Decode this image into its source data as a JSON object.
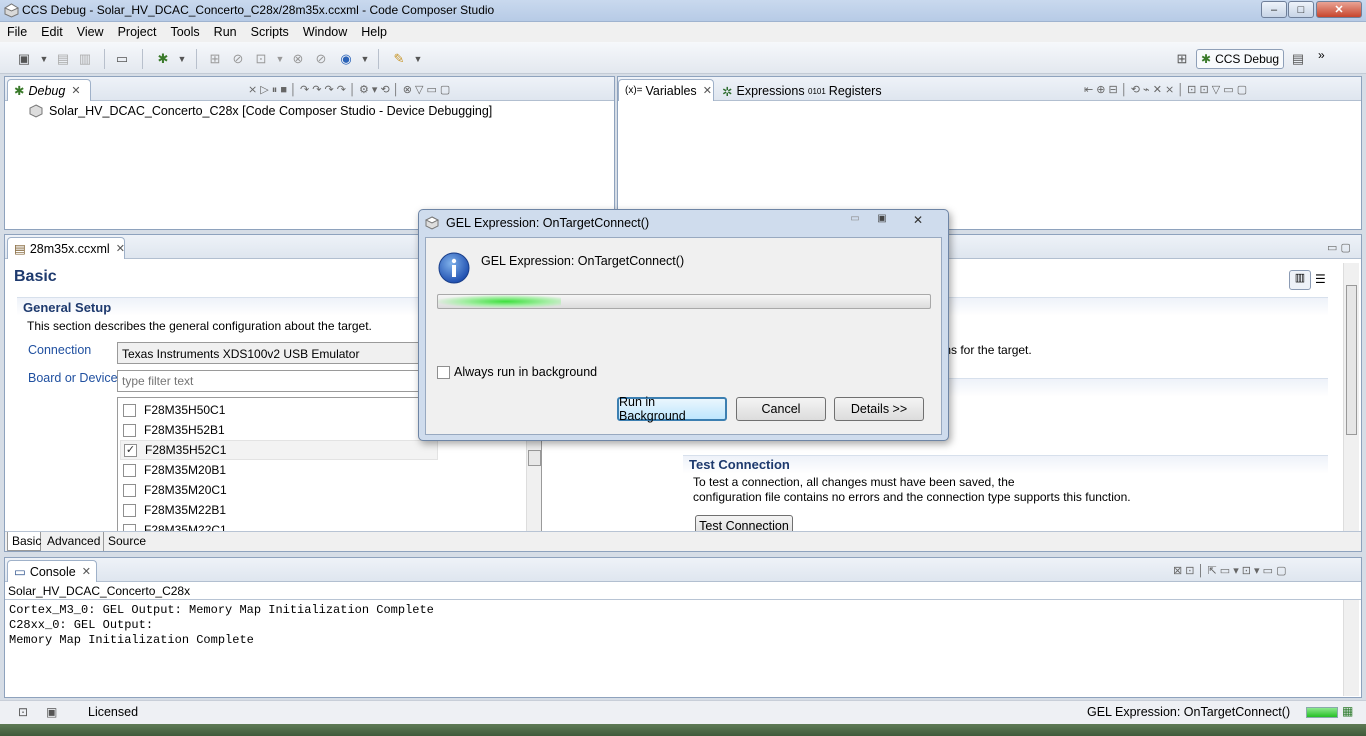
{
  "window": {
    "title": "CCS Debug - Solar_HV_DCAC_Concerto_C28x/28m35x.ccxml - Code Composer Studio",
    "controls": [
      "–",
      "□",
      "✕"
    ]
  },
  "menu": [
    "File",
    "Edit",
    "View",
    "Project",
    "Tools",
    "Run",
    "Scripts",
    "Window",
    "Help"
  ],
  "perspective": {
    "label": "CCS Debug",
    "overflow": "»"
  },
  "debug_view": {
    "tab": "Debug",
    "tree_item": "Solar_HV_DCAC_Concerto_C28x [Code Composer Studio - Device Debugging]"
  },
  "variables_view": {
    "tabs": [
      "Variables",
      "Expressions",
      "Registers"
    ],
    "tab_icons": [
      "(x)=",
      "",
      "0101"
    ]
  },
  "editor": {
    "tab": "28m35x.ccxml",
    "heading": "Basic",
    "general_setup": {
      "title": "General Setup",
      "desc": "This section describes the general configuration about the target.",
      "connection_label": "Connection",
      "connection_value": "Texas Instruments XDS100v2 USB Emulator",
      "board_label": "Board or Device",
      "filter_placeholder": "type filter text",
      "devices": [
        {
          "name": "F28M35H50C1",
          "checked": false
        },
        {
          "name": "F28M35H52B1",
          "checked": false
        },
        {
          "name": "F28M35H52C1",
          "checked": true
        },
        {
          "name": "F28M35M20B1",
          "checked": false
        },
        {
          "name": "F28M35M20C1",
          "checked": false
        },
        {
          "name": "F28M35M22B1",
          "checked": false
        },
        {
          "name": "F28M35M22C1",
          "checked": false
        }
      ]
    },
    "right_fragment": "ions for the target.",
    "test_connection": {
      "title": "Test Connection",
      "desc1": "To test a connection, all changes must have been saved, the",
      "desc2": "configuration file contains no errors and the connection type supports this function.",
      "button": "Test Connection"
    },
    "bottom_tabs": [
      "Basic",
      "Advanced",
      "Source"
    ]
  },
  "console": {
    "tab": "Console",
    "subtitle": "Solar_HV_DCAC_Concerto_C28x",
    "lines": [
      "Cortex_M3_0: GEL Output: Memory Map Initialization Complete",
      "C28xx_0: GEL Output:",
      "Memory Map Initialization Complete"
    ]
  },
  "status": {
    "license": "Licensed",
    "message": "GEL Expression: OnTargetConnect()"
  },
  "dialog": {
    "title": "GEL Expression: OnTargetConnect()",
    "message": "GEL Expression: OnTargetConnect()",
    "progress": 0.25,
    "checkbox_label": "Always run in background",
    "checkbox_checked": false,
    "buttons": {
      "run_bg": "Run in Background",
      "cancel": "Cancel",
      "details": "Details >>"
    }
  },
  "colors": {
    "accent": "#3c7fb1",
    "progress": "#2fd12f",
    "section": "#1e3a6e"
  }
}
